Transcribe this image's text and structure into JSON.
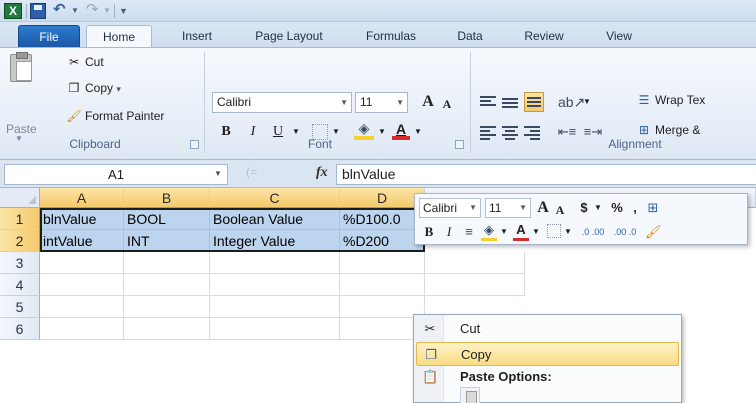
{
  "app": {
    "name": "Microsoft Excel",
    "logo": "X"
  },
  "qat": {
    "icons": [
      "excel-logo-icon",
      "save-icon",
      "undo-icon",
      "redo-icon",
      "customize-icon"
    ],
    "undo_glyph": "↶",
    "redo_glyph": "↷"
  },
  "tabs": [
    {
      "label": "File"
    },
    {
      "label": "Home"
    },
    {
      "label": "Insert"
    },
    {
      "label": "Page Layout"
    },
    {
      "label": "Formulas"
    },
    {
      "label": "Data"
    },
    {
      "label": "Review"
    },
    {
      "label": "View"
    }
  ],
  "ribbon": {
    "clipboard": {
      "label": "Clipboard",
      "paste": "Paste",
      "cut": "Cut",
      "copy": "Copy",
      "copy_arrow": "▾",
      "format_painter": "Format Painter"
    },
    "font": {
      "label": "Font",
      "family": "Calibri",
      "size": "11",
      "bold": "B",
      "italic": "I",
      "underline": "U",
      "grow": "A",
      "shrink": "A"
    },
    "alignment": {
      "label": "Alignment",
      "wrap_text": "Wrap Tex",
      "merge": "Merge &"
    }
  },
  "formula_bar": {
    "name_box": "A1",
    "fx": "fx",
    "value": "blnValue"
  },
  "grid": {
    "columns": [
      "A",
      "B",
      "C",
      "D"
    ],
    "rows": [
      "1",
      "2",
      "3",
      "4",
      "5",
      "6"
    ],
    "cells": [
      [
        "blnValue",
        "BOOL",
        "Boolean Value",
        "%D100.0"
      ],
      [
        "intValue",
        "INT",
        "Integer Value",
        "%D200"
      ]
    ]
  },
  "mini_toolbar": {
    "font": "Calibri",
    "size": "11",
    "grow": "A",
    "shrink": "A",
    "currency": "$",
    "percent": "%",
    "comma": ",",
    "bold": "B",
    "italic": "I",
    "inc_decimal": ".0 .00",
    "dec_decimal": ".00 .0"
  },
  "context_menu": {
    "items": [
      {
        "label": "Cut",
        "icon": "scissors-icon"
      },
      {
        "label": "Copy",
        "icon": "copy-icon",
        "highlighted": true
      },
      {
        "label": "Paste Options:",
        "icon": "paste-icon",
        "header": true
      }
    ]
  },
  "colors": {
    "accent": "#1f5fa8",
    "selection": "#bcd4ee",
    "highlight": "#f9dc84"
  }
}
